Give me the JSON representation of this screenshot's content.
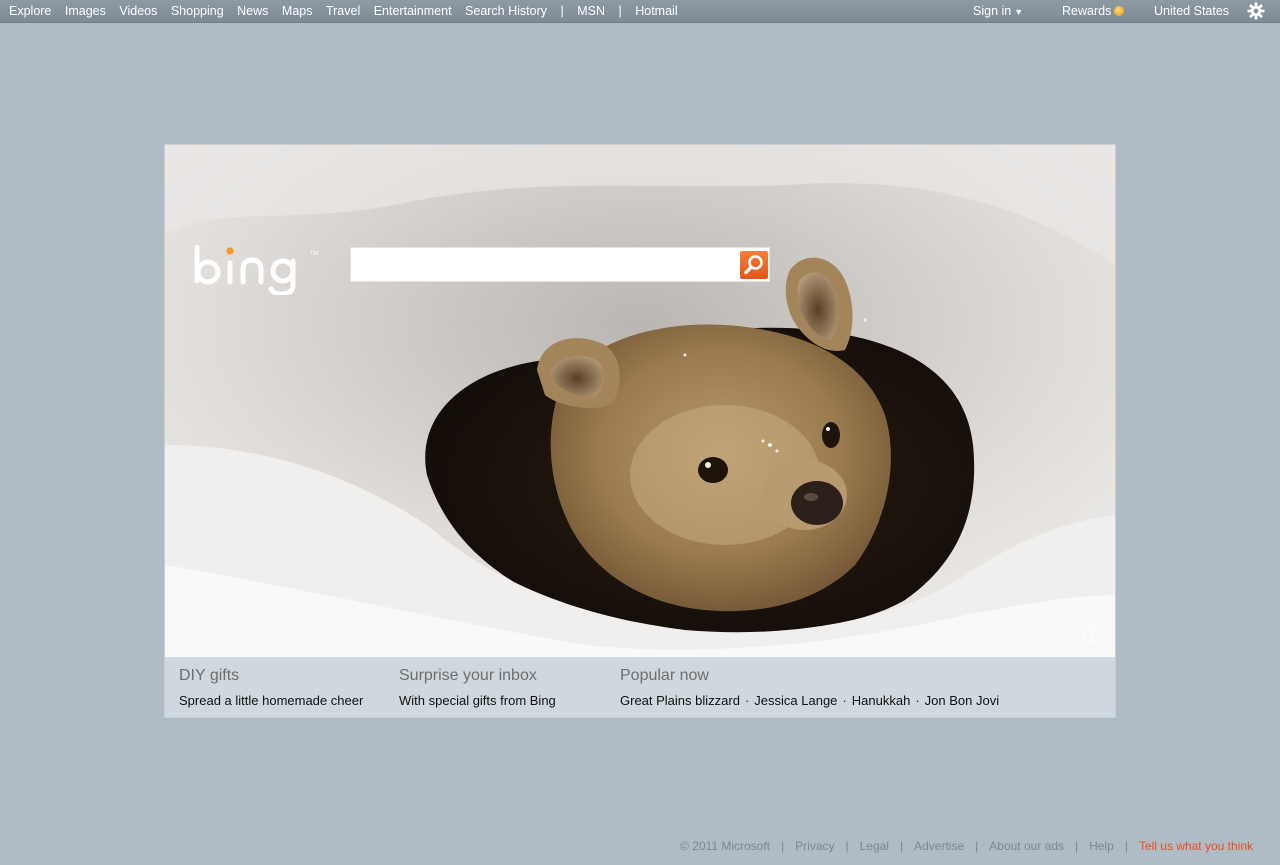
{
  "nav": {
    "items": [
      "Explore",
      "Images",
      "Videos",
      "Shopping",
      "News",
      "Maps",
      "Travel",
      "Entertainment",
      "Search History"
    ],
    "msn": "MSN",
    "hotmail": "Hotmail",
    "separator": "|",
    "sign_in": "Sign in",
    "rewards": "Rewards",
    "region": "United States"
  },
  "search": {
    "placeholder": ""
  },
  "promos": [
    {
      "title": "DIY gifts",
      "subtitle": "Spread a little homemade cheer"
    },
    {
      "title": "Surprise your inbox",
      "subtitle": "With special gifts from Bing"
    }
  ],
  "popular": {
    "title": "Popular now",
    "items": [
      "Great Plains blizzard",
      "Jessica Lange",
      "Hanukkah",
      "Jon Bon Jovi"
    ]
  },
  "footer": {
    "copyright": "© 2011 Microsoft",
    "links": [
      "Privacy",
      "Legal",
      "Advertise",
      "About our ads",
      "Help"
    ],
    "feedback": "Tell us what you think"
  },
  "colors": {
    "accent": "#e8501d",
    "background": "#b0bcc5",
    "strip": "#cfd8de"
  },
  "icons": [
    "gear-icon",
    "search-icon",
    "info-icon",
    "caret-down-icon",
    "rewards-coin-icon"
  ]
}
